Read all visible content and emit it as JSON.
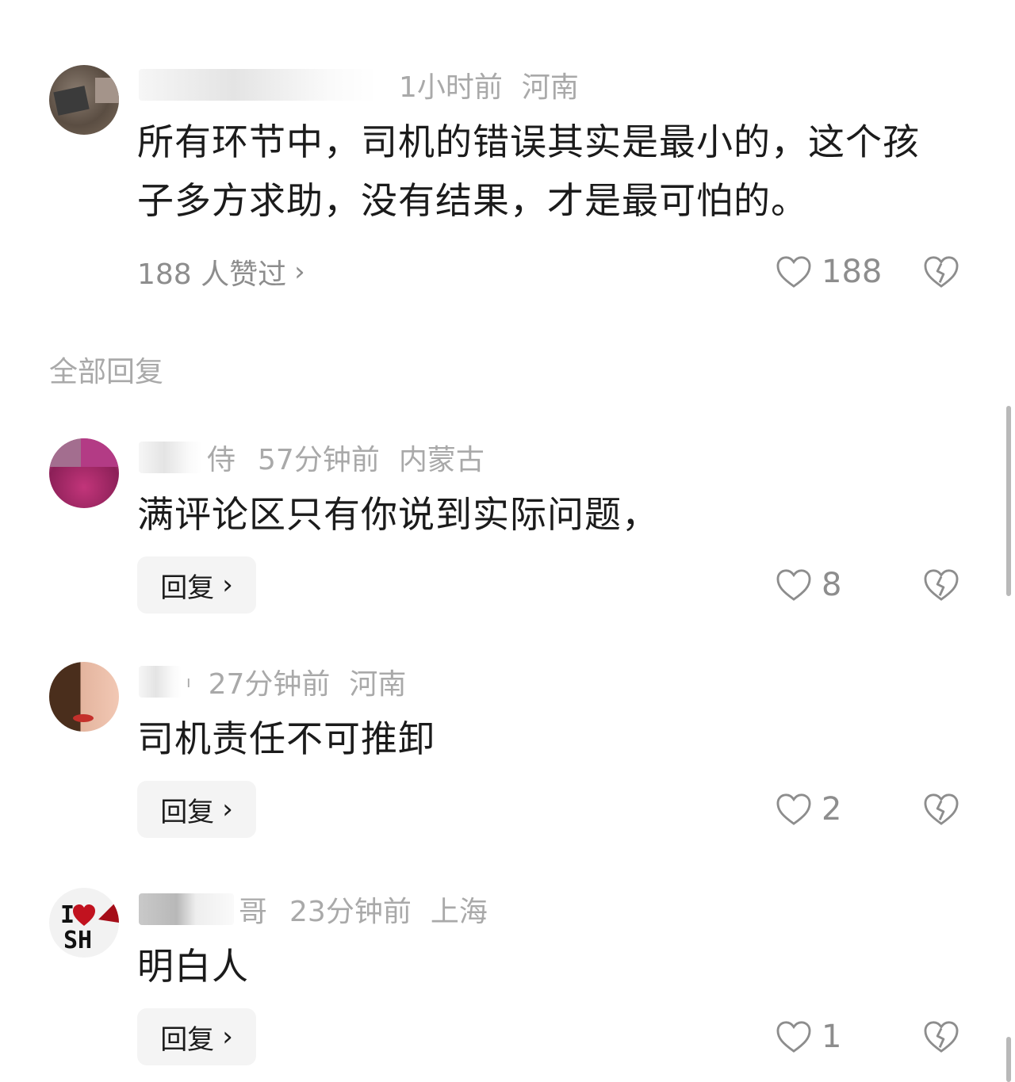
{
  "main_comment": {
    "time": "1小时前",
    "location": "河南",
    "text": "所有环节中，司机的错误其实是最小的，这个孩子多方求助，没有结果，才是最可怕的。",
    "likers_label": "188 人赞过",
    "like_count": "188"
  },
  "section_title": "全部回复",
  "replies": [
    {
      "name_suffix": "侍",
      "time": "57分钟前",
      "location": "内蒙古",
      "text": "满评论区只有你说到实际问题，",
      "reply_label": "回复",
      "like_count": "8"
    },
    {
      "name_suffix": "ı",
      "time": "27分钟前",
      "location": "河南",
      "text": "司机责任不可推卸",
      "reply_label": "回复",
      "like_count": "2"
    },
    {
      "name_suffix": "哥",
      "time": "23分钟前",
      "location": "上海",
      "text": "明白人",
      "reply_label": "回复",
      "like_count": "1",
      "avatar_text": "I SH"
    }
  ],
  "icons": {
    "like": "heart-outline-icon",
    "dislike": "broken-heart-icon",
    "chevron": "chevron-right-icon"
  },
  "colors": {
    "text": "#1b1b1b",
    "meta": "#a9a9a9",
    "icon": "#8d8d8d",
    "reply_bg": "#f4f4f4",
    "avatar_heart": "#c1121f"
  }
}
